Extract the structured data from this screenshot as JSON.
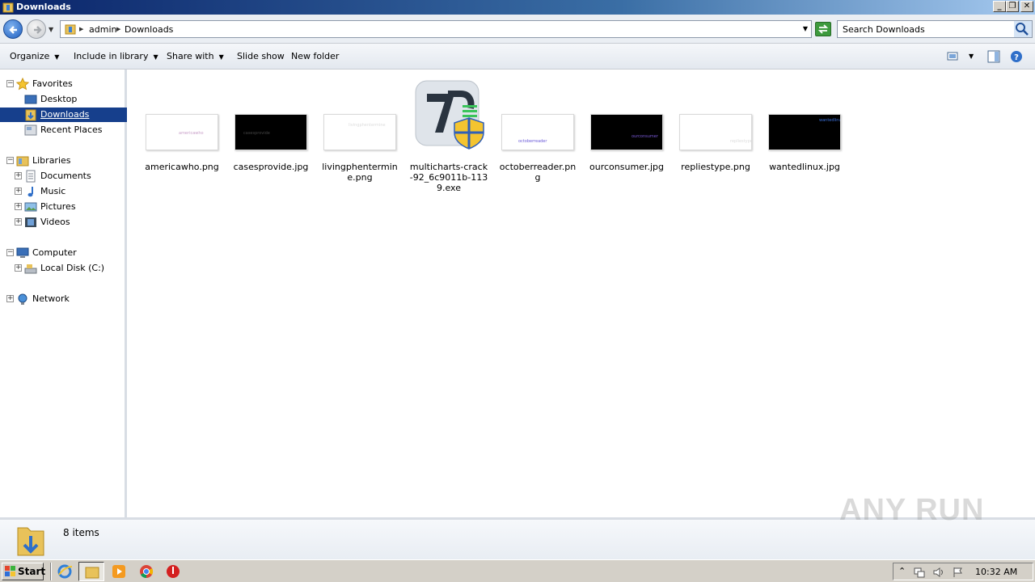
{
  "window": {
    "title": "Downloads"
  },
  "address": {
    "crumbs": [
      "admin",
      "Downloads"
    ],
    "search_placeholder": "Search Downloads"
  },
  "toolbar": {
    "organize": "Organize",
    "include_in_library": "Include in library",
    "share_with": "Share with",
    "slide_show": "Slide show",
    "new_folder": "New folder"
  },
  "nav": {
    "favorites": "Favorites",
    "desktop": "Desktop",
    "downloads": "Downloads",
    "recent_places": "Recent Places",
    "libraries": "Libraries",
    "documents": "Documents",
    "music": "Music",
    "pictures": "Pictures",
    "videos": "Videos",
    "computer": "Computer",
    "local_disk": "Local Disk (C:)",
    "network": "Network"
  },
  "files": [
    {
      "name": "americawho.png",
      "thumb_text": "americawho"
    },
    {
      "name": "casesprovide.jpg",
      "thumb_text": "casesprovide"
    },
    {
      "name": "livingphentermine.png",
      "thumb_text": "livingphentermine"
    },
    {
      "name": "multicharts-crack-92_6c9011b-1139.exe"
    },
    {
      "name": "octoberreader.png",
      "thumb_text": "octoberreader"
    },
    {
      "name": "ourconsumer.jpg",
      "thumb_text": "ourconsumer"
    },
    {
      "name": "repliestype.png",
      "thumb_text": "repliestype"
    },
    {
      "name": "wantedlinux.jpg",
      "thumb_text": "wantedlinux"
    }
  ],
  "status": {
    "item_count": "8 items"
  },
  "watermark": "ANY RUN",
  "taskbar": {
    "start": "Start",
    "clock": "10:32 AM"
  }
}
